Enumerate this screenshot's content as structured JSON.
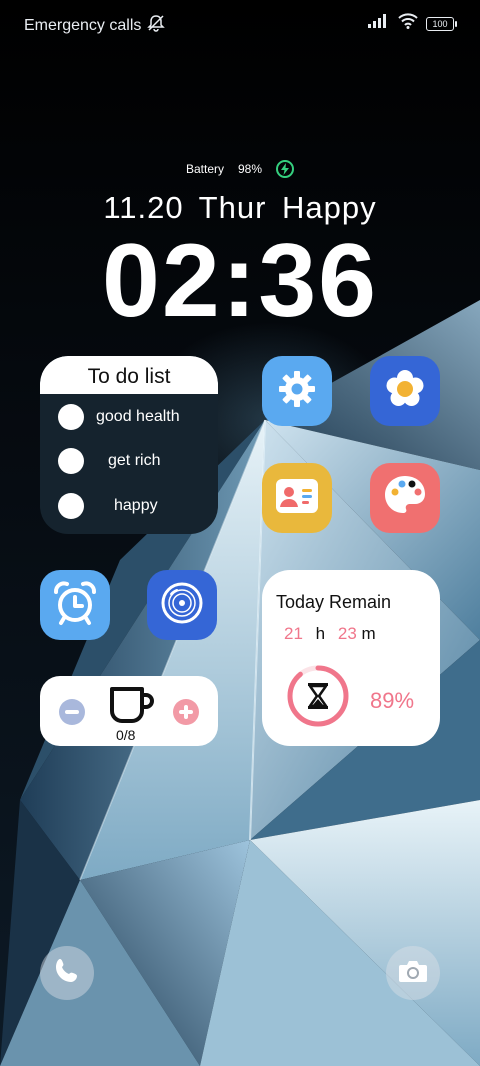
{
  "status_bar": {
    "carrier_text": "Emergency calls",
    "battery_level": "100",
    "icons": [
      "bell-muted-icon",
      "signal-icon",
      "wifi-icon",
      "battery-icon"
    ]
  },
  "lockscreen": {
    "battery_label": "Battery",
    "battery_percent": "98%",
    "charging_icon": "lightning-icon",
    "date_line": "11.20 Thur  Happy",
    "time": "02:36"
  },
  "todo_widget": {
    "title": "To do list",
    "items": [
      {
        "label": "good health"
      },
      {
        "label": "get rich"
      },
      {
        "label": "happy"
      }
    ]
  },
  "apps": [
    {
      "name": "settings",
      "icon": "gear-icon",
      "color": "#5aa9f0"
    },
    {
      "name": "gallery",
      "icon": "flower-icon",
      "color": "#3566d6"
    },
    {
      "name": "contacts",
      "icon": "contact-card-icon",
      "color": "#e9b83c"
    },
    {
      "name": "themes",
      "icon": "palette-icon",
      "color": "#f07070"
    },
    {
      "name": "clock",
      "icon": "alarm-clock-icon",
      "color": "#5aa9f0"
    },
    {
      "name": "music",
      "icon": "vinyl-disc-icon",
      "color": "#3566d6"
    }
  ],
  "water_widget": {
    "count": "0/8",
    "icons": [
      "minus-icon",
      "cup-icon",
      "plus-icon"
    ]
  },
  "remain_widget": {
    "title": "Today Remain",
    "hours": "21",
    "hours_unit": "h",
    "minutes": "23",
    "minutes_unit": "m",
    "percent": "89%",
    "progress": 0.89,
    "accent": "#f0768b"
  },
  "dock": {
    "left_icon": "phone-icon",
    "right_icon": "camera-icon"
  }
}
